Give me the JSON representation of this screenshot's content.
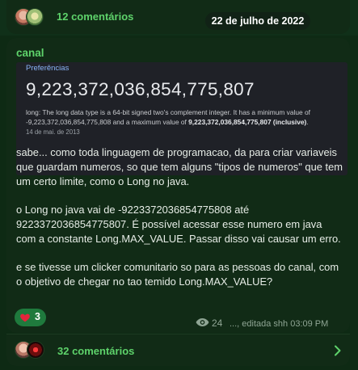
{
  "previous_post": {
    "comments_label": "12 comentários"
  },
  "date_separator": "22 de julho de 2022",
  "post": {
    "channel_name": "canal",
    "embed": {
      "top_link": "Preferências",
      "big_number": "9,223,372,036,854,775,807",
      "desc_part1": "long: The long data type is a 64-bit signed two's complement integer. It has a minimum value of -9,223,372,036,854,775,808 and a maximum value of ",
      "desc_bold": "9,223,372,036,854,775,807 (inclusive)",
      "desc_part2": ".",
      "date": "14 de mai. de 2013"
    },
    "paragraphs": [
      "sabe... como toda linguagem de programacao, da para criar variaveis que guardam numeros, so que tem alguns \"tipos de numeros\" que tem um certo limite, como o Long no java.",
      "o Long no java vai de -9223372036854775808 até 9223372036854775807. É possível acessar esse numero em java com a constante Long.MAX_VALUE. Passar disso vai causar um erro.",
      "e se tivesse um clicker comunitario so para as pessoas do canal, com o objetivo de chegar no tao temido Long.MAX_VALUE?"
    ],
    "reaction": {
      "icon": "heart-icon",
      "count": "3"
    },
    "views": "24",
    "edited_info": "..., editada shh 03:09 PM"
  },
  "comments_bar": {
    "label": "32 comentários"
  },
  "colors": {
    "background": "#0e2a14",
    "card": "#112b16",
    "accent_green": "#5ed36b",
    "reaction_bg": "#1f7a3d",
    "embed_bg": "#1f2127"
  }
}
